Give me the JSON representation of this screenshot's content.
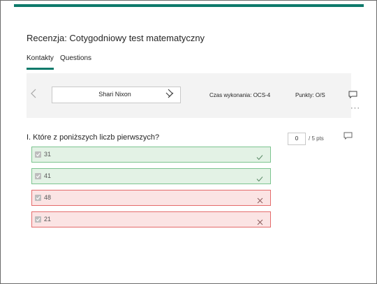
{
  "form": {
    "title": "Recenzja: Cotygodniowy test matematyczny"
  },
  "tabs": [
    {
      "label": "Kontakty",
      "active": true
    },
    {
      "label": "Questions",
      "active": false
    }
  ],
  "respondent": {
    "name": "Shari Nixon",
    "time_label": "Czas wykonania: OCS-4",
    "points_label": "Punkty: O/S"
  },
  "question": {
    "text": "I. Które z poniższych liczb pierwszych?",
    "score_value": "0",
    "score_total": "/ 5 pts"
  },
  "answers": [
    {
      "value": "31",
      "status": "correct",
      "checked": true
    },
    {
      "value": "41",
      "status": "correct",
      "checked": true
    },
    {
      "value": "48",
      "status": "wrong",
      "checked": true
    },
    {
      "value": "21",
      "status": "wrong",
      "checked": true
    }
  ],
  "icons": {
    "prev": "chevron-left-icon",
    "next": "chevron-right-icon",
    "dropdown": "chevron-down-icon",
    "comment": "comment-icon",
    "more": "more-icon",
    "correct": "check-icon",
    "wrong": "close-icon"
  },
  "colors": {
    "accent": "#0e7a6b",
    "correct_bg": "#e3f2e5",
    "correct_border": "#7cc48f",
    "wrong_bg": "#fbe4e4",
    "wrong_border": "#e46b6b"
  }
}
